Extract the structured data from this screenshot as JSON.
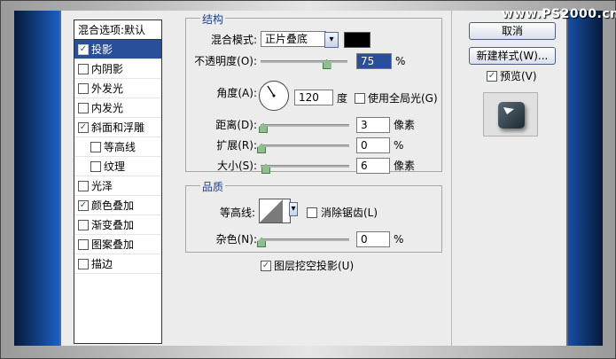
{
  "watermark": "www.PS2000.cn",
  "style_list": {
    "header": "混合选项:默认",
    "items": [
      {
        "label": "投影",
        "checked": true,
        "selected": true,
        "indent": false
      },
      {
        "label": "内阴影",
        "checked": false,
        "selected": false,
        "indent": false
      },
      {
        "label": "外发光",
        "checked": false,
        "selected": false,
        "indent": false
      },
      {
        "label": "内发光",
        "checked": false,
        "selected": false,
        "indent": false
      },
      {
        "label": "斜面和浮雕",
        "checked": true,
        "selected": false,
        "indent": false
      },
      {
        "label": "等高线",
        "checked": false,
        "selected": false,
        "indent": true
      },
      {
        "label": "纹理",
        "checked": false,
        "selected": false,
        "indent": true
      },
      {
        "label": "光泽",
        "checked": false,
        "selected": false,
        "indent": false
      },
      {
        "label": "颜色叠加",
        "checked": true,
        "selected": false,
        "indent": false
      },
      {
        "label": "渐变叠加",
        "checked": false,
        "selected": false,
        "indent": false
      },
      {
        "label": "图案叠加",
        "checked": false,
        "selected": false,
        "indent": false
      },
      {
        "label": "描边",
        "checked": false,
        "selected": false,
        "indent": false
      }
    ]
  },
  "structure": {
    "title": "结构",
    "blend_mode_label": "混合模式:",
    "blend_mode_value": "正片叠底",
    "blend_color": "#000000",
    "opacity_label": "不透明度(O):",
    "opacity_value": "75",
    "opacity_unit": "%",
    "opacity_fraction": 0.75,
    "angle_label": "角度(A):",
    "angle_value": "120",
    "angle_unit": "度",
    "global_light_label": "使用全局光(G)",
    "global_light_checked": false,
    "distance_label": "距离(D):",
    "distance_value": "3",
    "distance_unit": "像素",
    "spread_label": "扩展(R):",
    "spread_value": "0",
    "spread_unit": "%",
    "size_label": "大小(S):",
    "size_value": "6",
    "size_unit": "像素"
  },
  "quality": {
    "title": "品质",
    "contour_label": "等高线:",
    "anti_alias_label": "消除锯齿(L)",
    "anti_alias_checked": false,
    "noise_label": "杂色(N):",
    "noise_value": "0",
    "noise_unit": "%",
    "knockout_label": "图层挖空投影(U)",
    "knockout_checked": true
  },
  "buttons": {
    "cancel": "取消",
    "new_style": "新建样式(W)...",
    "preview_label": "预览(V)",
    "preview_checked": true
  }
}
